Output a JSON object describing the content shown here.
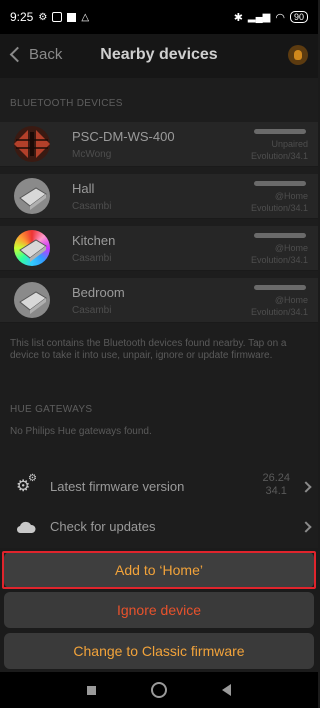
{
  "statusbar": {
    "time": "9:25",
    "battery": "90"
  },
  "nav": {
    "back_label": "Back",
    "title": "Nearby devices"
  },
  "bluetooth": {
    "header": "BLUETOOTH DEVICES",
    "devices": [
      {
        "name": "PSC-DM-WS-400",
        "vendor": "McWong",
        "status": "Unpaired",
        "firmware": "Evolution/34.1"
      },
      {
        "name": "Hall",
        "vendor": "Casambi",
        "status": "@Home",
        "firmware": "Evolution/34.1"
      },
      {
        "name": "Kitchen",
        "vendor": "Casambi",
        "status": "@Home",
        "firmware": "Evolution/34.1"
      },
      {
        "name": "Bedroom",
        "vendor": "Casambi",
        "status": "@Home",
        "firmware": "Evolution/34.1"
      }
    ],
    "info": "This list contains the Bluetooth devices found nearby. Tap on a device to take it into use, unpair, ignore or update firmware."
  },
  "hue": {
    "header": "HUE GATEWAYS",
    "empty": "No Philips Hue gateways found."
  },
  "firmware_row": {
    "label": "Latest firmware version",
    "value_line1": "26.24",
    "value_line2": "34.1"
  },
  "updates_row": {
    "label": "Check for updates"
  },
  "actions": {
    "add": "Add to ‘Home’",
    "ignore": "Ignore device",
    "change": "Change to Classic firmware"
  },
  "colors": {
    "accent": "#f2a33a",
    "danger": "#e8522c",
    "highlight": "#e0242c"
  }
}
